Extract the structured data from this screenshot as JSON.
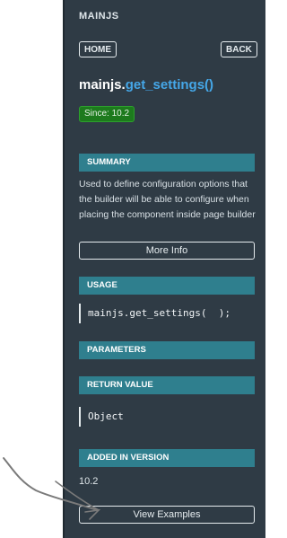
{
  "panel": {
    "title": "MAINJS",
    "home_label": "HOME",
    "back_label": "BACK",
    "function": {
      "object": "mainjs",
      "dot": ".",
      "name": "get_settings()"
    },
    "since_badge": "Since: 10.2",
    "sections": {
      "summary": {
        "heading": "SUMMARY",
        "text": "Used to define configuration options that the builder will be able to configure when placing the component inside page builder",
        "button": "More Info"
      },
      "usage": {
        "heading": "USAGE",
        "code": "mainjs.get_settings(  );"
      },
      "parameters": {
        "heading": "PARAMETERS"
      },
      "return_value": {
        "heading": "RETURN VALUE",
        "code": "Object"
      },
      "added_in_version": {
        "heading": "ADDED IN VERSION",
        "value": "10.2"
      }
    },
    "examples_button": "View Examples"
  },
  "colors": {
    "panel_bg": "#2f3b45",
    "section_bar": "#2f7f8e",
    "function_name": "#45a7e8",
    "since_badge_bg": "#1d7a1d"
  }
}
